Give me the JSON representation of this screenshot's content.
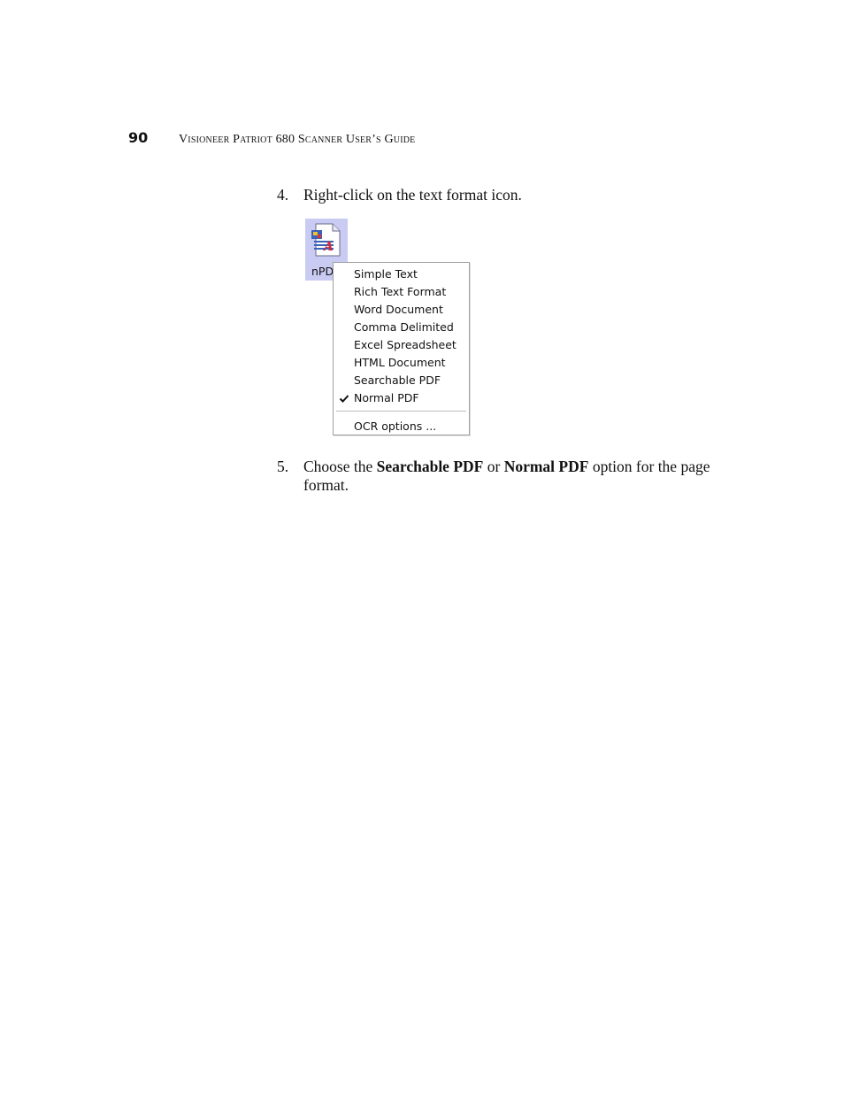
{
  "header": {
    "page_number": "90",
    "running_title": "Visioneer Patriot 680 Scanner User’s Guide"
  },
  "steps": [
    {
      "number": "4.",
      "text": "Right-click on the text format icon."
    },
    {
      "number": "5.",
      "prefix": "Choose the ",
      "bold1": "Searchable PDF",
      "middle": " or ",
      "bold2": "Normal PDF",
      "suffix": " option for the page format."
    }
  ],
  "figure": {
    "icon": {
      "name": "text-format-icon",
      "label": "nPD"
    },
    "menu": {
      "items": [
        {
          "label": "Simple Text",
          "checked": false
        },
        {
          "label": "Rich Text Format",
          "checked": false
        },
        {
          "label": "Word Document",
          "checked": false
        },
        {
          "label": "Comma Delimited",
          "checked": false
        },
        {
          "label": "Excel Spreadsheet",
          "checked": false
        },
        {
          "label": "HTML Document",
          "checked": false
        },
        {
          "label": "Searchable PDF",
          "checked": false
        },
        {
          "label": "Normal PDF",
          "checked": true
        }
      ],
      "footer_item": "OCR options ..."
    }
  },
  "colors": {
    "icon_selection": "#c9cbf3",
    "menu_border": "#a0a0a0"
  }
}
